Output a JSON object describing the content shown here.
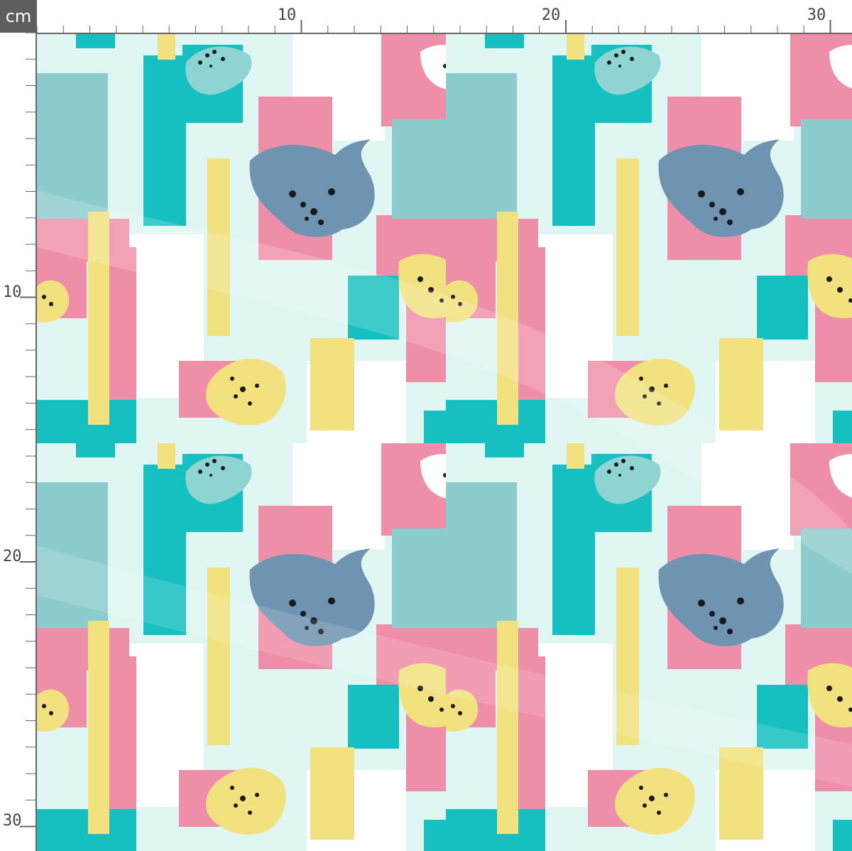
{
  "ruler": {
    "unit_label": "cm",
    "top_labels": [
      "10",
      "20",
      "30"
    ],
    "left_labels": [
      "10",
      "20",
      "30"
    ]
  },
  "colors": {
    "teal": "#17c0c0",
    "mint": "#dff6f3",
    "pink": "#ef8ea8",
    "yellow": "#f1e27f",
    "slate": "#6f94b2",
    "sage": "#8dcccc",
    "white": "#ffffff",
    "ruler_badge": "#5e5e5e"
  },
  "pattern": {
    "name": "abstract brushstroke floral print",
    "motifs": [
      "brush-stroke",
      "flower-blob",
      "black-speckles"
    ]
  }
}
